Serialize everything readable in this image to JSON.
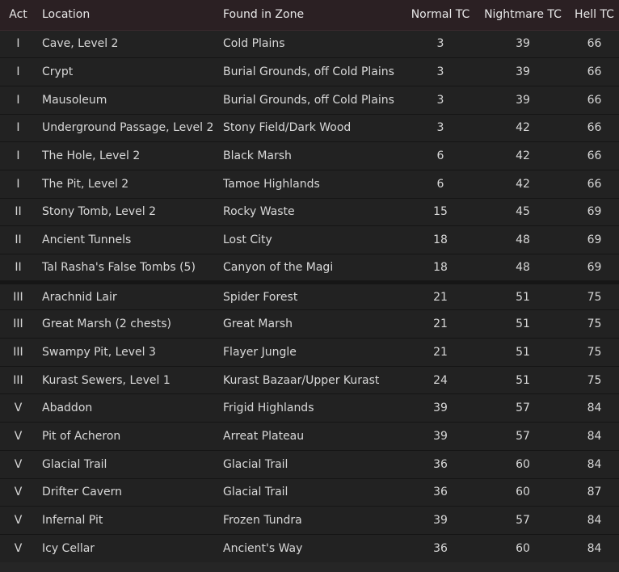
{
  "table": {
    "headers": {
      "act": "Act",
      "location": "Location",
      "zone": "Found in Zone",
      "normal": "Normal TC",
      "nightmare": "Nightmare TC",
      "hell": "Hell TC"
    },
    "rows": [
      {
        "act": "I",
        "location": "Cave, Level 2",
        "zone": "Cold Plains",
        "normal": "3",
        "nightmare": "39",
        "hell": "66"
      },
      {
        "act": "I",
        "location": "Crypt",
        "zone": "Burial Grounds, off Cold Plains",
        "normal": "3",
        "nightmare": "39",
        "hell": "66"
      },
      {
        "act": "I",
        "location": "Mausoleum",
        "zone": "Burial Grounds, off Cold Plains",
        "normal": "3",
        "nightmare": "39",
        "hell": "66"
      },
      {
        "act": "I",
        "location": "Underground Passage, Level 2",
        "zone": "Stony Field/Dark Wood",
        "normal": "3",
        "nightmare": "42",
        "hell": "66"
      },
      {
        "act": "I",
        "location": "The Hole, Level 2",
        "zone": "Black Marsh",
        "normal": "6",
        "nightmare": "42",
        "hell": "66"
      },
      {
        "act": "I",
        "location": "The Pit, Level 2",
        "zone": "Tamoe Highlands",
        "normal": "6",
        "nightmare": "42",
        "hell": "66"
      },
      {
        "act": "II",
        "location": "Stony Tomb, Level 2",
        "zone": "Rocky Waste",
        "normal": "15",
        "nightmare": "45",
        "hell": "69"
      },
      {
        "act": "II",
        "location": "Ancient Tunnels",
        "zone": "Lost City",
        "normal": "18",
        "nightmare": "48",
        "hell": "69"
      },
      {
        "act": "II",
        "location": "Tal Rasha's False Tombs (5)",
        "zone": "Canyon of the Magi",
        "normal": "18",
        "nightmare": "48",
        "hell": "69"
      },
      {
        "act": "III",
        "location": "Arachnid Lair",
        "zone": "Spider Forest",
        "normal": "21",
        "nightmare": "51",
        "hell": "75"
      },
      {
        "act": "III",
        "location": "Great Marsh (2 chests)",
        "zone": "Great Marsh",
        "normal": "21",
        "nightmare": "51",
        "hell": "75"
      },
      {
        "act": "III",
        "location": "Swampy Pit, Level 3",
        "zone": "Flayer Jungle",
        "normal": "21",
        "nightmare": "51",
        "hell": "75"
      },
      {
        "act": "III",
        "location": "Kurast Sewers, Level 1",
        "zone": "Kurast Bazaar/Upper Kurast",
        "normal": "24",
        "nightmare": "51",
        "hell": "75"
      },
      {
        "act": "V",
        "location": "Abaddon",
        "zone": "Frigid Highlands",
        "normal": "39",
        "nightmare": "57",
        "hell": "84"
      },
      {
        "act": "V",
        "location": "Pit of Acheron",
        "zone": "Arreat Plateau",
        "normal": "39",
        "nightmare": "57",
        "hell": "84"
      },
      {
        "act": "V",
        "location": "Glacial Trail",
        "zone": "Glacial Trail",
        "normal": "36",
        "nightmare": "60",
        "hell": "84"
      },
      {
        "act": "V",
        "location": "Drifter Cavern",
        "zone": "Glacial Trail",
        "normal": "36",
        "nightmare": "60",
        "hell": "87"
      },
      {
        "act": "V",
        "location": "Infernal Pit",
        "zone": "Frozen Tundra",
        "normal": "39",
        "nightmare": "57",
        "hell": "84"
      },
      {
        "act": "V",
        "location": "Icy Cellar",
        "zone": "Ancient's Way",
        "normal": "36",
        "nightmare": "60",
        "hell": "84"
      }
    ]
  },
  "colors": {
    "header_bg": "#2b2023",
    "row_bg": "#222222",
    "text": "#d8d8d8"
  }
}
